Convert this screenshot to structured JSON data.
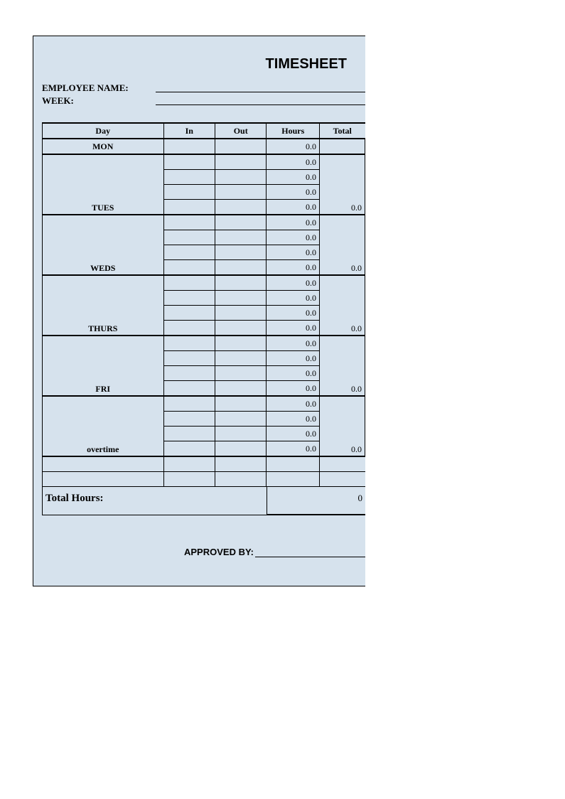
{
  "title": "TIMESHEET",
  "header": {
    "employee_name_label": "EMPLOYEE NAME:",
    "week_label": "WEEK:"
  },
  "columns": {
    "day": "Day",
    "in": "In",
    "out": "Out",
    "hours": "Hours",
    "total": "Total"
  },
  "days": {
    "mon": "MON",
    "tues": "TUES",
    "weds": "WEDS",
    "thurs": "THURS",
    "fri": "FRI",
    "overtime": "overtime"
  },
  "blocks": [
    {
      "key": "mon",
      "rows": 1,
      "total": ""
    },
    {
      "key": "tues",
      "rows": 4,
      "total": "0.0"
    },
    {
      "key": "weds",
      "rows": 4,
      "total": "0.0"
    },
    {
      "key": "thurs",
      "rows": 4,
      "total": "0.0"
    },
    {
      "key": "fri",
      "rows": 4,
      "total": "0.0"
    },
    {
      "key": "overtime",
      "rows": 4,
      "total": "0.0"
    }
  ],
  "hours_cell_default": "0.0",
  "total_hours_label": "Total Hours:",
  "total_hours_value": "0",
  "approved_by_label": "APPROVED BY:"
}
